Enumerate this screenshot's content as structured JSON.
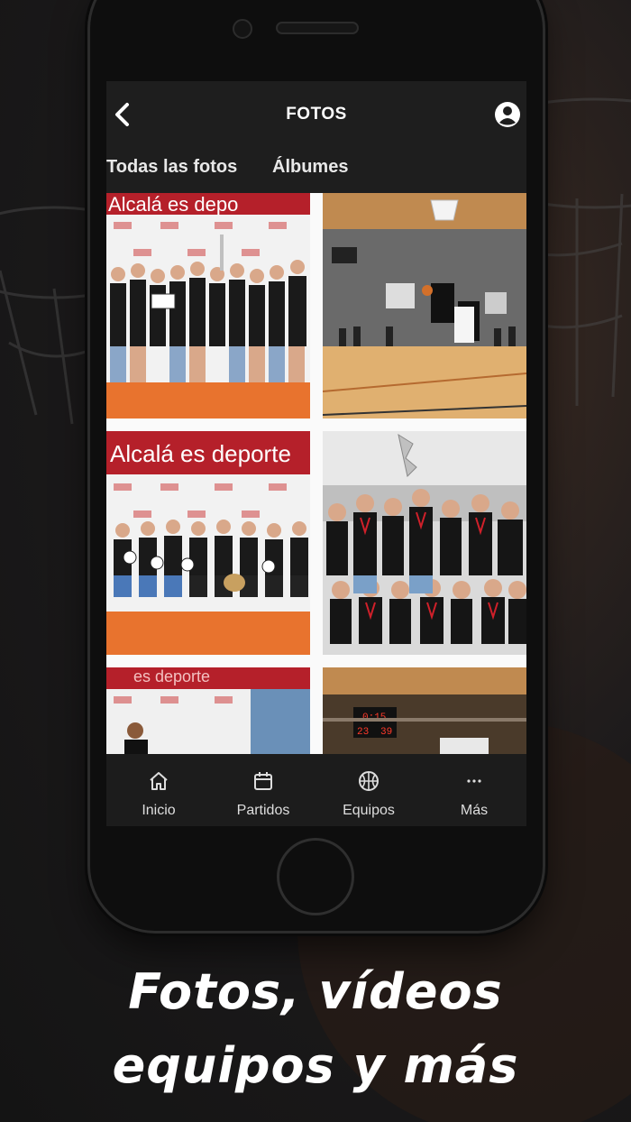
{
  "header": {
    "title": "FOTOS",
    "back_icon": "chevron-left-icon",
    "profile_icon": "user-circle-icon"
  },
  "tabs": [
    {
      "label": "Todas las fotos"
    },
    {
      "label": "Álbumes"
    }
  ],
  "photos": [
    {
      "banner": "Alcalá es depo",
      "description": "Group of girls in black shirts with trophy"
    },
    {
      "banner": "",
      "description": "Basketball game action in gym"
    },
    {
      "banner": "Alcalá es deporte",
      "description": "Group of boys with balls and trophy"
    },
    {
      "banner": "",
      "description": "Girls with medals and trophy"
    },
    {
      "banner": "es deporte",
      "description": "Player in front of sponsor wall"
    },
    {
      "banner": "",
      "description": "Scoreboard in gym"
    }
  ],
  "scoreboard": {
    "time": "0:15",
    "score_left": "23",
    "score_right": "39"
  },
  "navbar": {
    "items": [
      {
        "label": "Inicio",
        "icon": "home-icon"
      },
      {
        "label": "Partidos",
        "icon": "calendar-icon"
      },
      {
        "label": "Equipos",
        "icon": "basketball-icon"
      },
      {
        "label": "Más",
        "icon": "more-icon"
      }
    ]
  },
  "caption": {
    "line1": "Fotos, vídeos",
    "line2": "equipos y más"
  },
  "colors": {
    "screen_bg": "#1e1e1e",
    "banner_red": "#b5202a",
    "floor_orange": "#e8732e",
    "text_white": "#ffffff"
  }
}
